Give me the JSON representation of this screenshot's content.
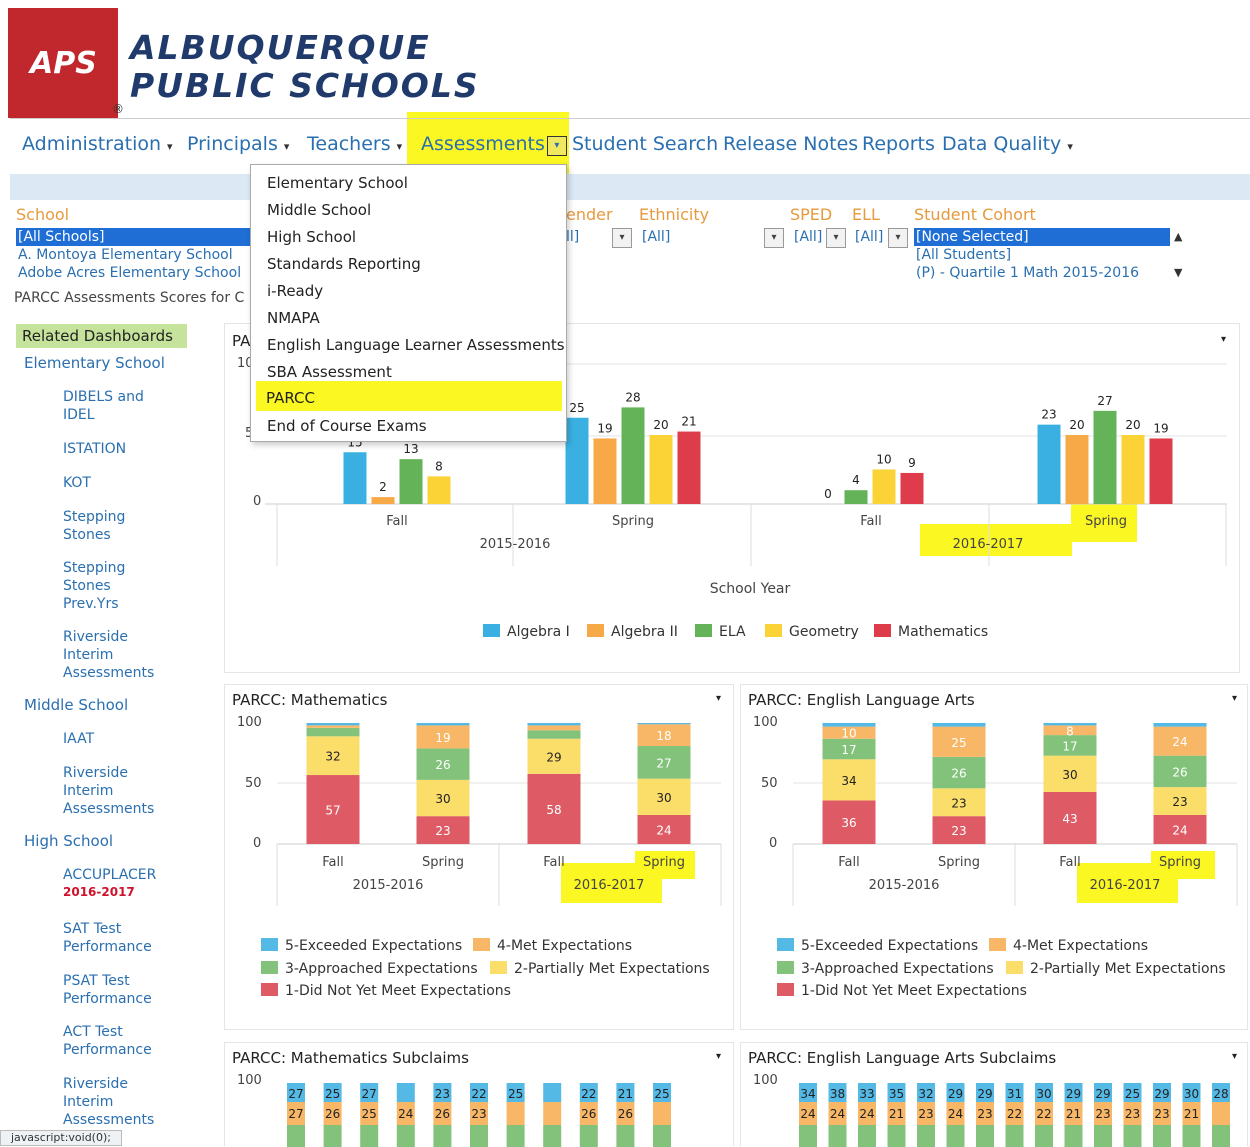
{
  "header": {
    "logo_text": "APS",
    "brand_line1": "ALBUQUERQUE",
    "brand_line2": "PUBLIC SCHOOLS"
  },
  "nav": {
    "administration": "Administration",
    "principals": "Principals",
    "teachers": "Teachers",
    "assessments": "Assessments",
    "student_search": "Student Search",
    "release_notes": "Release Notes",
    "reports": "Reports",
    "data_quality": "Data Quality"
  },
  "menu": {
    "items": [
      "Elementary School",
      "Middle School",
      "High School",
      "Standards Reporting",
      "i-Ready",
      "NMAPA",
      "English Language Learner Assessments",
      "SBA Assessment",
      "PARCC",
      "End of Course Exams"
    ],
    "highlighted": "PARCC"
  },
  "filters": {
    "school_label": "School",
    "school_options": [
      "[All Schools]",
      "A. Montoya Elementary School",
      "Adobe Acres Elementary School"
    ],
    "gender_label": "ender",
    "gender_value": "ll]",
    "ethnicity_label": "Ethnicity",
    "ethnicity_value": "[All]",
    "sped_label": "SPED",
    "sped_value": "[All]",
    "ell_label": "ELL",
    "ell_value": "[All]",
    "cohort_label": "Student Cohort",
    "cohort_options": [
      "[None Selected]",
      "[All Students]",
      "(P) - Quartile 1 Math 2015-2016"
    ],
    "caption": "PARCC Assessments Scores for C"
  },
  "sidebar": {
    "heading": "Related Dashboards",
    "sections": [
      {
        "label": "Elementary School",
        "items": [
          "DIBELS and IDEL",
          "ISTATION",
          "KOT",
          "Stepping Stones",
          "Stepping Stones Prev.Yrs",
          "Riverside Interim Assessments"
        ]
      },
      {
        "label": "Middle School",
        "items": [
          "IAAT",
          "Riverside Interim Assessments"
        ]
      },
      {
        "label": "High School",
        "items": [
          "ACCUPLACER",
          "SAT Test Performance",
          "PSAT Test Performance",
          "ACT Test Performance",
          "Riverside Interim Assessments"
        ]
      }
    ],
    "accuplacer_badge": "2016-2017"
  },
  "panels": {
    "top_title_prefix": "PA",
    "top_ticks": [
      "10",
      "5",
      "0"
    ],
    "school_year_label": "School Year",
    "math_title": "PARCC: Mathematics",
    "ela_title": "PARCC: English Language Arts",
    "math_sub_title": "PARCC: Mathematics Subclaims",
    "ela_sub_title": "PARCC: English Language Arts Subclaims",
    "axis_ticks": [
      "100",
      "50",
      "0"
    ],
    "sub_tick": "100"
  },
  "chart_data": [
    {
      "type": "bar",
      "xlabel": "School Year",
      "groups": [
        {
          "year": "2015-2016",
          "term": "Fall",
          "values": {
            "Algebra I": 15,
            "Algebra II": 2,
            "ELA": 13,
            "Geometry": 8
          }
        },
        {
          "year": "2015-2016",
          "term": "Spring",
          "values": {
            "Algebra I": 25,
            "Algebra II": 19,
            "ELA": 28,
            "Geometry": 20,
            "Mathematics": 21
          }
        },
        {
          "year": "2016-2017",
          "term": "Fall",
          "values": {
            "Algebra II": 0,
            "ELA": 4,
            "Geometry": 10,
            "Mathematics": 9
          }
        },
        {
          "year": "2016-2017",
          "term": "Spring",
          "values": {
            "Algebra I": 23,
            "Algebra II": 20,
            "ELA": 27,
            "Geometry": 20,
            "Mathematics": 19
          }
        }
      ],
      "legend": [
        "Algebra I",
        "Algebra II",
        "ELA",
        "Geometry",
        "Mathematics"
      ],
      "colors": [
        "#3ab0e2",
        "#f7a948",
        "#64b358",
        "#fbd336",
        "#de3c4b"
      ]
    },
    {
      "type": "bar",
      "stacked": true,
      "title": "PARCC: Mathematics",
      "categories": [
        "Fall 2015-2016",
        "Spring 2015-2016",
        "Fall 2016-2017",
        "Spring 2016-2017"
      ],
      "series": [
        {
          "name": "1-Did Not Yet Meet Expectations",
          "values": [
            57,
            23,
            58,
            24
          ]
        },
        {
          "name": "2-Partially Met Expectations",
          "values": [
            32,
            30,
            29,
            30
          ]
        },
        {
          "name": "3-Approached Expectations",
          "values": [
            7,
            26,
            7,
            27
          ]
        },
        {
          "name": "4-Met Expectations",
          "values": [
            2,
            19,
            4,
            18
          ]
        },
        {
          "name": "5-Exceeded Expectations",
          "values": [
            2,
            2,
            2,
            1
          ]
        }
      ],
      "ylim": [
        0,
        100
      ]
    },
    {
      "type": "bar",
      "stacked": true,
      "title": "PARCC: English Language Arts",
      "categories": [
        "Fall 2015-2016",
        "Spring 2015-2016",
        "Fall 2016-2017",
        "Spring 2016-2017"
      ],
      "series": [
        {
          "name": "1-Did Not Yet Meet Expectations",
          "values": [
            36,
            23,
            43,
            24
          ]
        },
        {
          "name": "2-Partially Met Expectations",
          "values": [
            34,
            23,
            30,
            23
          ]
        },
        {
          "name": "3-Approached Expectations",
          "values": [
            17,
            26,
            17,
            26
          ]
        },
        {
          "name": "4-Met Expectations",
          "values": [
            10,
            25,
            8,
            24
          ]
        },
        {
          "name": "5-Exceeded Expectations",
          "values": [
            3,
            3,
            2,
            3
          ]
        }
      ],
      "ylim": [
        0,
        100
      ]
    }
  ],
  "legend_stack": [
    "5-Exceeded Expectations",
    "4-Met Expectations",
    "3-Approached Expectations",
    "2-Partially Met Expectations",
    "1-Did Not Yet Meet Expectations"
  ],
  "stack_colors": [
    "#de5b66",
    "#fbdd6a",
    "#83c27a",
    "#f8b766",
    "#55b9e6"
  ],
  "xaxis": {
    "fall": "Fall",
    "spring": "Spring",
    "y1": "2015-2016",
    "y2": "2016-2017"
  },
  "subclaims": {
    "math_top": [
      "27",
      "25",
      "27",
      "",
      "23",
      "22",
      "25",
      "",
      "22",
      "21",
      "25"
    ],
    "math_second": [
      "27",
      "26",
      "25",
      "24",
      "26",
      "23",
      "",
      "",
      "26",
      "26",
      ""
    ],
    "ela_top": [
      "34",
      "38",
      "33",
      "35",
      "32",
      "29",
      "29",
      "31",
      "30",
      "29",
      "29",
      "25",
      "29",
      "30",
      "28"
    ],
    "ela_second": [
      "24",
      "24",
      "24",
      "21",
      "23",
      "24",
      "23",
      "22",
      "22",
      "21",
      "23",
      "23",
      "23",
      "21",
      ""
    ]
  },
  "status_bar": "javascript:void(0);"
}
